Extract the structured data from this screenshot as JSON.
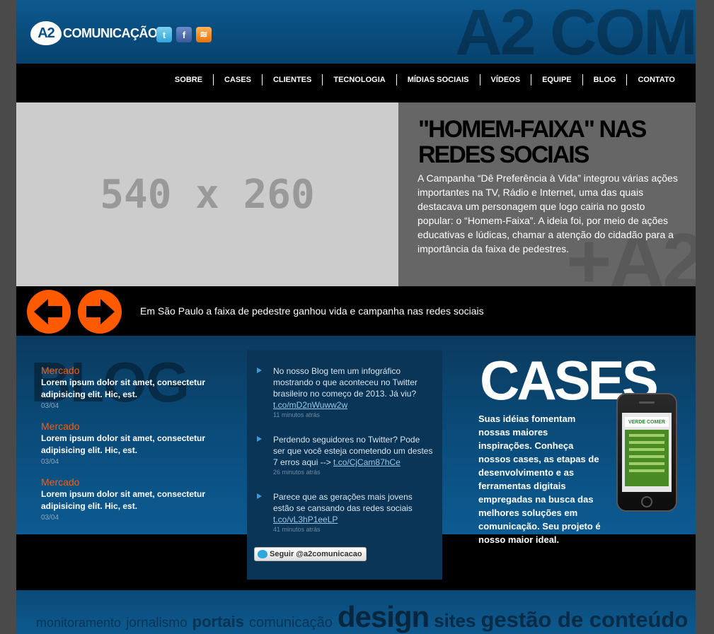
{
  "header": {
    "logo_mark": "A2",
    "logo_text": "COMUNICAÇÃO",
    "watermark": "A2 COM",
    "social": [
      {
        "name": "twitter",
        "glyph": "t"
      },
      {
        "name": "facebook",
        "glyph": "f"
      },
      {
        "name": "rss",
        "glyph": "≋"
      }
    ]
  },
  "nav": {
    "items": [
      "SOBRE",
      "CASES",
      "CLIENTES",
      "TECNOLOGIA",
      "MÍDIAS SOCIAIS",
      "VÍDEOS",
      "EQUIPE",
      "BLOG",
      "CONTATO"
    ]
  },
  "feature": {
    "placeholder": "540 x 260",
    "title": "\"HOMEM-FAIXA\" NAS REDES SOCIAIS",
    "body": "A Campanha “Dê Preferência à Vida” integrou várias ações importantes na TV, Rádio e Internet, uma das quais destacava um personagem que logo cairia no gosto popular: o “Homem-Faixa”. A ideia foi, por meio de ações educativas e lúdicas, chamar a atenção do cidadão para a importância da faixa de pedestres.",
    "watermark": "+A2"
  },
  "slider": {
    "caption": "Em São Paulo a faixa de pedestre ganhou vida e campanha nas redes sociais"
  },
  "blog": {
    "watermark": "BLOG",
    "items": [
      {
        "category": "Mercado",
        "excerpt": "Lorem ipsum dolor sit amet, consectetur adipisicing elit. Hic, est.",
        "date": "03/04"
      },
      {
        "category": "Mercado",
        "excerpt": "Lorem ipsum dolor sit amet, consectetur adipisicing elit. Hic, est.",
        "date": "03/04"
      },
      {
        "category": "Mercado",
        "excerpt": "Lorem ipsum dolor sit amet, consectetur adipisicing elit. Hic, est.",
        "date": "03/04"
      }
    ]
  },
  "tweets": {
    "items": [
      {
        "text": "No nosso Blog tem um infográfico mostrando o que aconteceu no Twitter brasileiro no começo de 2013. Já viu? ",
        "link": "t.co/mD2nWuww2w",
        "time": "11 minutos atrás"
      },
      {
        "text": "Perdendo seguidores no Twitter? Pode ser que você esteja cometendo um destes 7 erros aqui --> ",
        "link": "t.co/CjCam87hCe",
        "time": "26 minutos atrás"
      },
      {
        "text": "Parece que as gerações mais jovens estão se cansando das redes sociais ",
        "link": "t.co/vL3hP1eeLP",
        "time": "41 minutos atrás"
      }
    ],
    "follow_label": "Seguir @a2comunicacao"
  },
  "cases": {
    "title": "CASES",
    "body": "Suas idéias fomentam nossas maiores inspirações. Conheça nossos cases, as etapas de desenvolvimento e as ferramentas digitais empregadas na busca das melhores soluções em comunicação. Seu projeto é nosso maior ideal.",
    "phone_brand": "VERDE COMER"
  },
  "tagcloud": {
    "words": [
      "monitoramento",
      "jornalismo",
      "portais",
      "comunicação",
      "design",
      "sites",
      "gestão de conteúdo"
    ]
  }
}
